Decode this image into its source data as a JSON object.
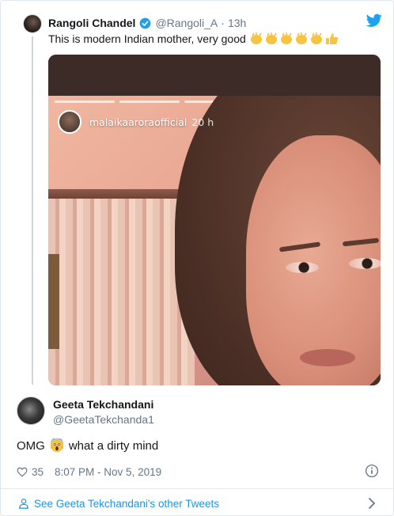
{
  "quoted_tweet": {
    "author_name": "Rangoli Chandel",
    "handle": "@Rangoli_A",
    "separator": "·",
    "time": "13h",
    "text": "This is modern Indian mother, very good",
    "emojis": [
      "clapping-hands",
      "clapping-hands",
      "clapping-hands",
      "clapping-hands",
      "clapping-hands",
      "thumbs-up"
    ],
    "media": {
      "story_username": "malaikaaroraofficial",
      "story_time": "20 h"
    }
  },
  "tweet": {
    "author_name": "Geeta Tekchandani",
    "handle": "@GeetaTekchanda1",
    "text_before": "OMG",
    "emoji": "face-screaming-in-fear",
    "text_after": "what a dirty mind",
    "likes": "35",
    "timestamp": "8:07 PM - Nov 5, 2019"
  },
  "footer": {
    "link_text": "See Geeta Tekchandani's other Tweets"
  },
  "colors": {
    "link_blue": "#1b95e0",
    "twitter_blue": "#1da1f2",
    "secondary_text": "#657786",
    "border": "#e1e8ed"
  }
}
